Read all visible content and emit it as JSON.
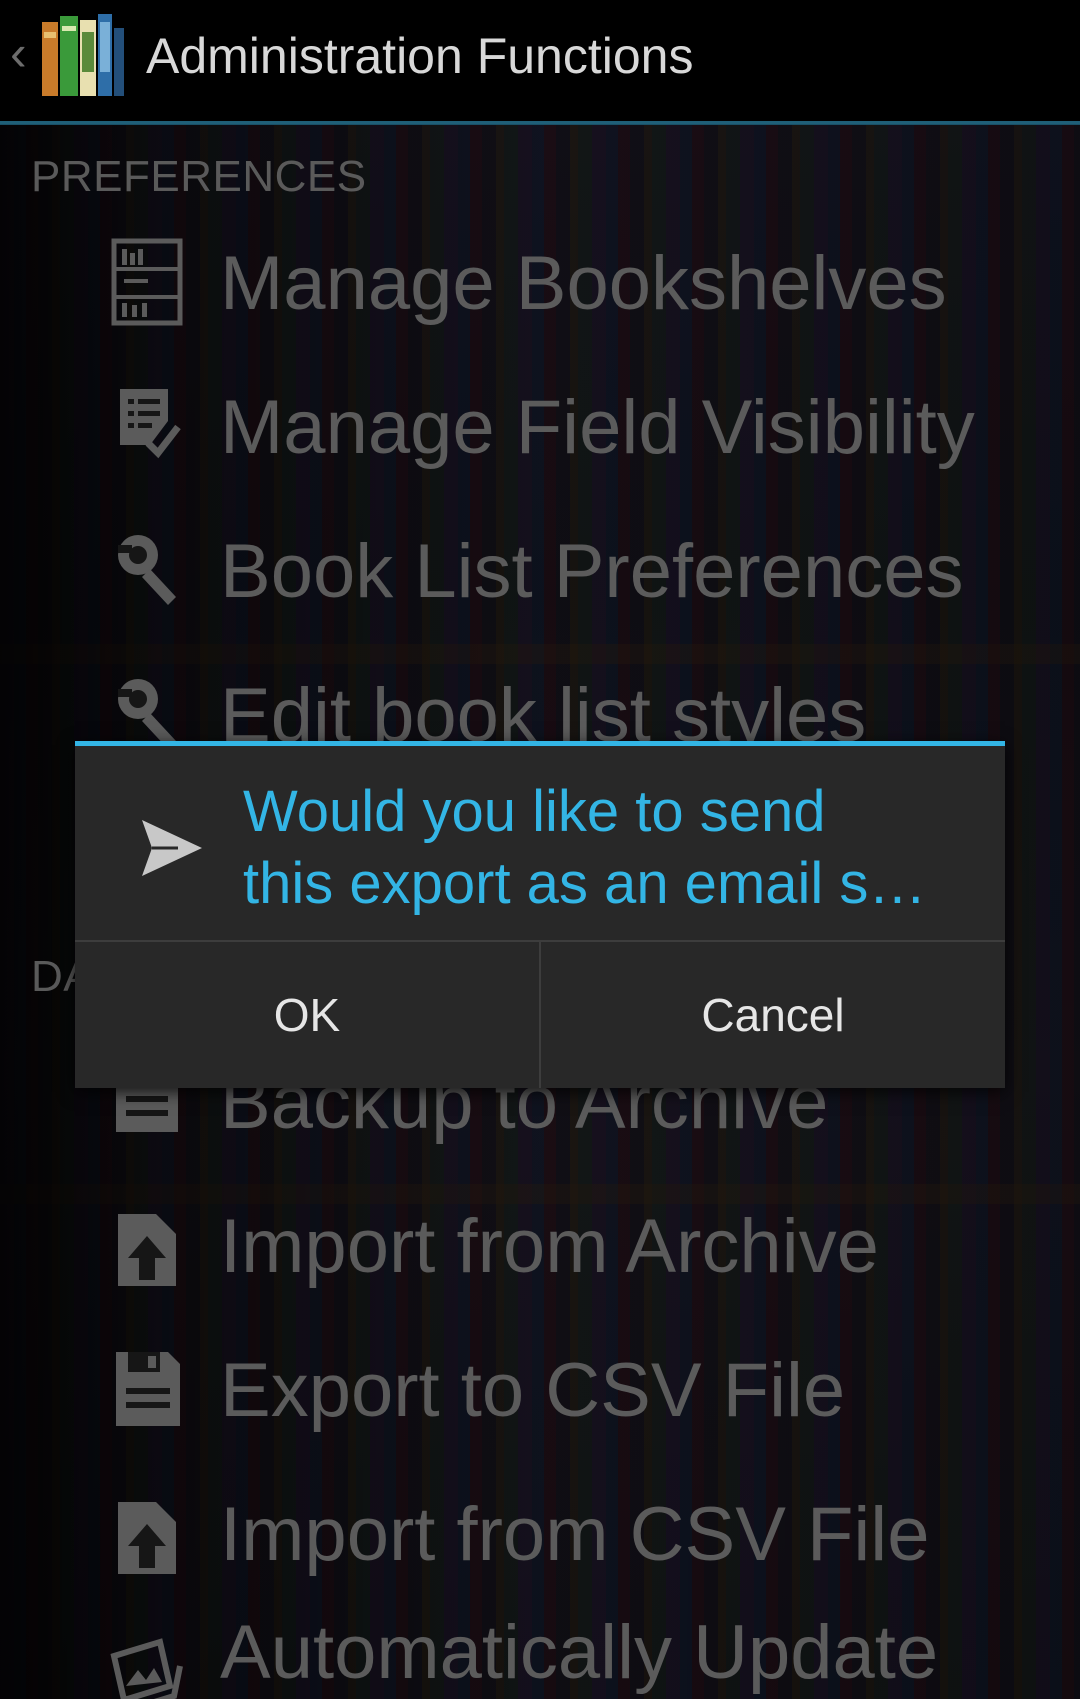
{
  "action_bar": {
    "title": "Administration Functions",
    "up_icon": "chevron-left-icon",
    "logo_icon": "books-logo-icon"
  },
  "sections": {
    "preferences_header": "PREFERENCES",
    "data_header": "DA"
  },
  "menu_items": [
    {
      "label": "Manage Bookshelves",
      "icon": "bookshelf-icon"
    },
    {
      "label": "Manage Field Visibility",
      "icon": "checklist-icon"
    },
    {
      "label": "Book List Preferences",
      "icon": "wrench-icon"
    },
    {
      "label": "Edit book list styles",
      "icon": "wrench-icon"
    },
    {
      "label": "Backup to Archive",
      "icon": "archive-icon"
    },
    {
      "label": "Import from Archive",
      "icon": "upload-icon"
    },
    {
      "label": "Export to CSV File",
      "icon": "save-icon"
    },
    {
      "label": "Import from CSV File",
      "icon": "upload-icon"
    },
    {
      "label": "Automatically Update",
      "icon": "image-update-icon"
    }
  ],
  "dialog": {
    "icon": "send-icon",
    "title_line1": "Would you like to send",
    "title_line2": "this export as an email s…",
    "ok_label": "OK",
    "cancel_label": "Cancel",
    "accent_color": "#33b5e5"
  }
}
